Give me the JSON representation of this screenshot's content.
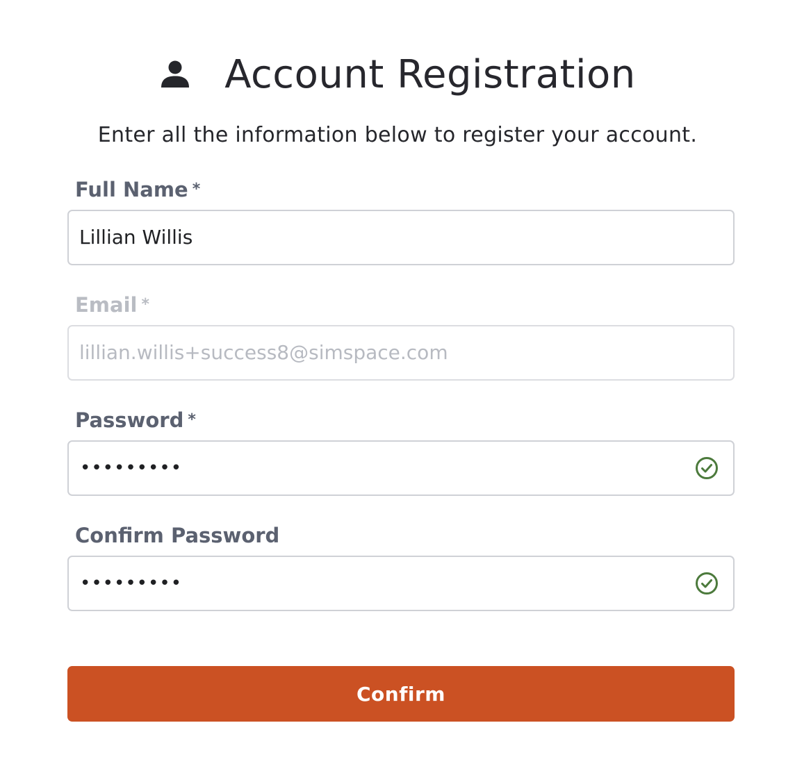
{
  "header": {
    "icon": "user-icon",
    "title": "Account Registration"
  },
  "subtitle": "Enter all the information below to register your account.",
  "form": {
    "full_name": {
      "label": "Full Name",
      "required_mark": "*",
      "value": "Lillian Willis"
    },
    "email": {
      "label": "Email",
      "required_mark": "*",
      "value": "lillian.willis+success8@simspace.com",
      "disabled": true
    },
    "password": {
      "label": "Password",
      "required_mark": "*",
      "masked_value": "•••••••••",
      "status_icon": "check-circle-icon"
    },
    "confirm_password": {
      "label": "Confirm Password",
      "masked_value": "•••••••••",
      "status_icon": "check-circle-icon"
    }
  },
  "confirm_button": {
    "label": "Confirm"
  },
  "colors": {
    "accent": "#cb5123",
    "valid": "#4c7a3c",
    "label": "#5b6170",
    "disabled_text": "#b7bac1"
  }
}
